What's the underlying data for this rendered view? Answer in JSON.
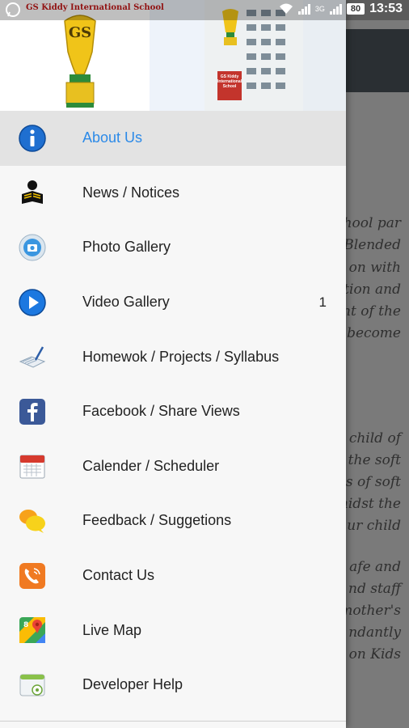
{
  "status_bar": {
    "time": "13:53",
    "battery": "80",
    "network": "3G",
    "app_title_mini": "GS Kiddy International School"
  },
  "header": {
    "trophy_text": "GS",
    "building_sign": "GS Kiddy International School"
  },
  "menu": {
    "items": [
      {
        "label": "About Us",
        "icon": "info-icon",
        "active": true
      },
      {
        "label": "News / Notices",
        "icon": "reader-icon"
      },
      {
        "label": "Photo Gallery",
        "icon": "photo-icon"
      },
      {
        "label": "Video Gallery",
        "icon": "play-icon",
        "badge": "1"
      },
      {
        "label": "Homewok / Projects / Syllabus",
        "icon": "notebook-pen-icon"
      },
      {
        "label": "Facebook / Share Views",
        "icon": "facebook-icon"
      },
      {
        "label": "Calender / Scheduler",
        "icon": "calendar-icon"
      },
      {
        "label": "Feedback / Suggetions",
        "icon": "chat-bubbles-icon"
      },
      {
        "label": "Contact Us",
        "icon": "phone-icon"
      },
      {
        "label": "Live Map",
        "icon": "map-icon"
      },
      {
        "label": "Developer Help",
        "icon": "help-icon"
      }
    ]
  },
  "background_text": {
    "lines": [
      "hool par",
      "Blended",
      "on with",
      "tion and",
      "nt of the",
      "become",
      "child of",
      "the soft",
      "s of soft",
      "midst the",
      "ur child",
      "afe and",
      "nd staff",
      "mother's",
      "ndantly",
      "on Kids"
    ]
  },
  "colors": {
    "accent": "#2c8ae8",
    "drawer_bg": "#f7f7f7",
    "active_row": "#e3e3e3",
    "toolbar": "#2a2f33"
  }
}
